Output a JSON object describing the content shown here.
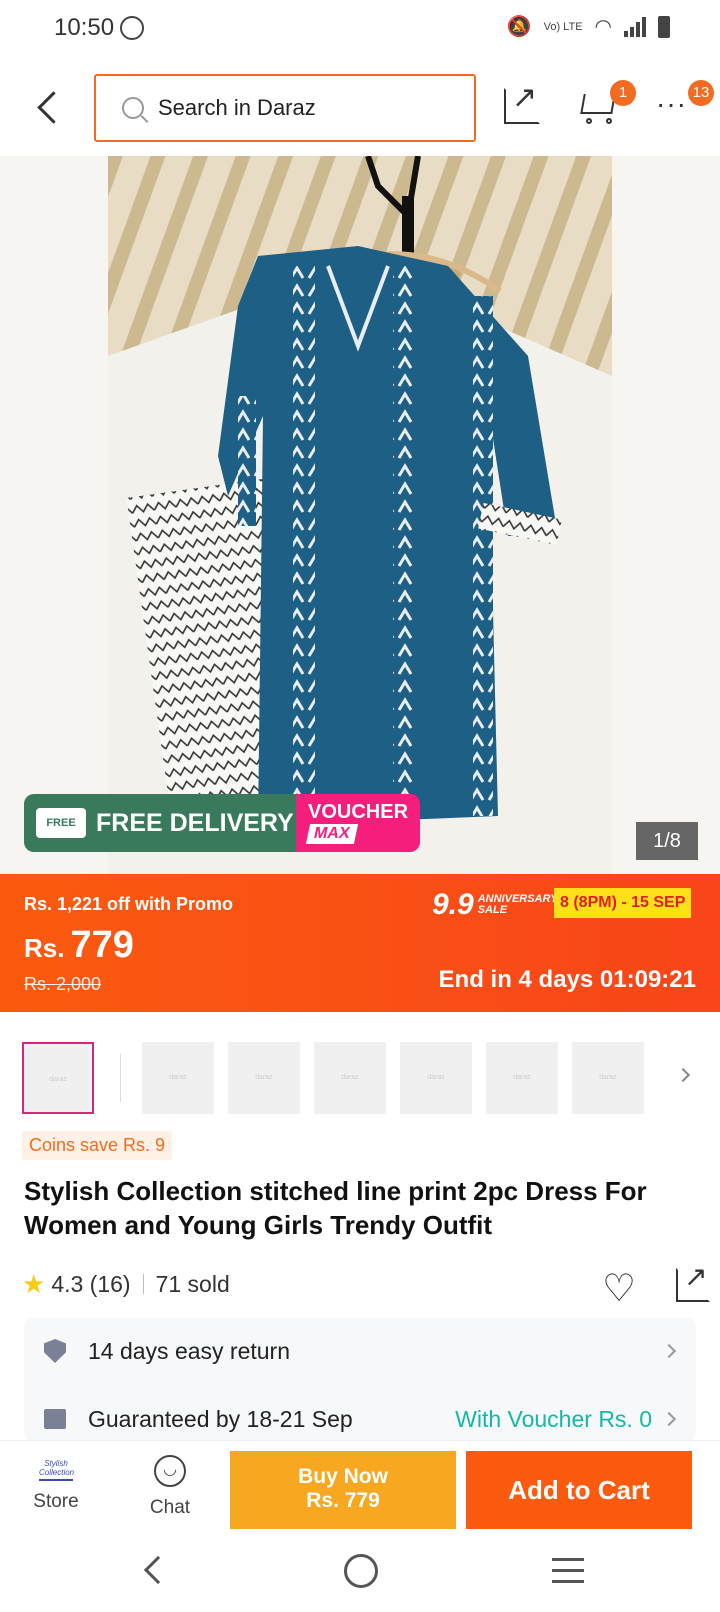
{
  "status": {
    "time": "10:50",
    "network": "Vo) LTE"
  },
  "header": {
    "search_placeholder": "Search in Daraz",
    "cart_count": "1",
    "more_count": "13"
  },
  "hero": {
    "free_delivery": "FREE DELIVERY",
    "truck_label": "FREE",
    "voucher": "VOUCHER",
    "voucher_max": "MAX",
    "image_counter": "1/8"
  },
  "price": {
    "promo": "Rs. 1,221 off with Promo",
    "currency": "Rs.",
    "amount": "779",
    "old_price": "Rs. 2,000",
    "sale_big": "9.9",
    "sale_small": "ANNIVERSARY SALE",
    "sale_dates": "8 (8PM) - 15 SEP",
    "countdown": "End in 4 days 01:09:21"
  },
  "thumbs": {
    "placeholder": "daraz"
  },
  "product": {
    "coins": "Coins save Rs. 9",
    "title": "Stylish Collection stitched line print 2pc Dress For Women and Young Girls Trendy Outfit",
    "rating": "4.3 (16)",
    "sold": "71 sold"
  },
  "service": {
    "return": "14 days easy return",
    "guarantee": "Guaranteed by 18-21 Sep",
    "voucher": "With Voucher Rs. 0"
  },
  "bottom": {
    "store_label": "Store",
    "store_logo_text": "Stylish Collection",
    "chat_label": "Chat",
    "buy_now_line1": "Buy Now",
    "buy_now_line2": "Rs. 779",
    "add_to_cart": "Add to Cart"
  }
}
